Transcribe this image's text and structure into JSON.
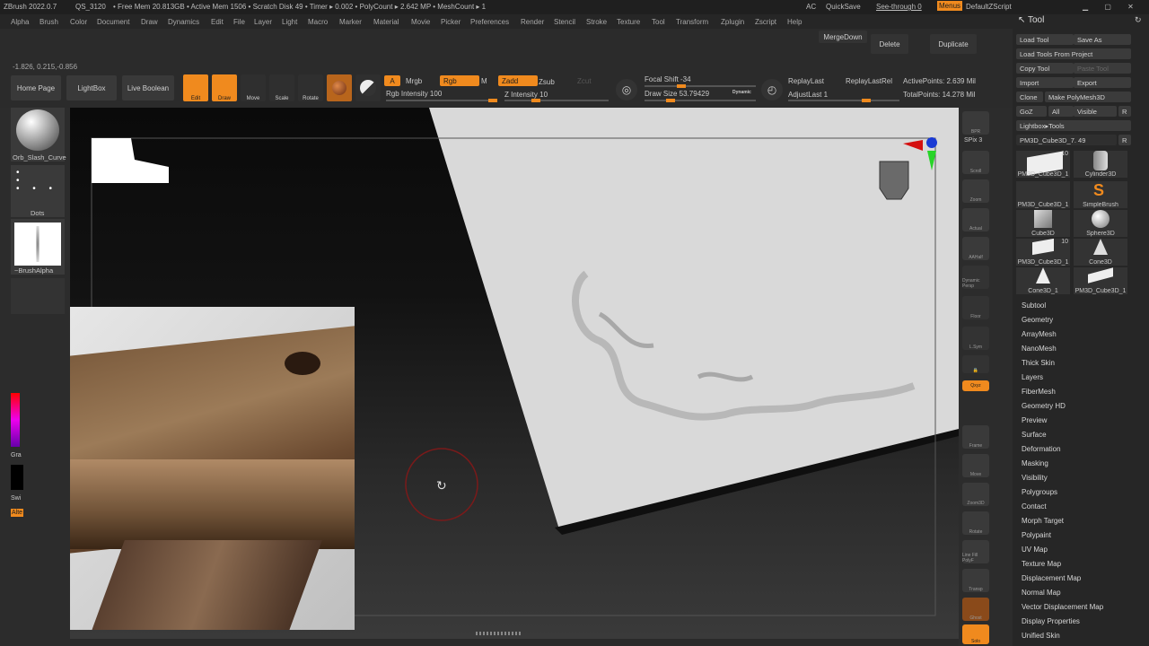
{
  "titlebar": {
    "app": "ZBrush 2022.0.7",
    "qs": "QS_3120",
    "stats": "• Free Mem 20.813GB • Active Mem 1506 • Scratch Disk 49 • Timer ▸ 0.002 • PolyCount ▸ 2.642 MP • MeshCount ▸ 1",
    "ac": "AC",
    "quicksave": "QuickSave",
    "see_through": "See-through  0",
    "menus": "Menus",
    "zscript": "DefaultZScript"
  },
  "menubar": [
    "Alpha",
    "Brush",
    "Color",
    "Document",
    "Draw",
    "Dynamics",
    "Edit",
    "File",
    "Layer",
    "Light",
    "Macro",
    "Marker",
    "Material",
    "Movie",
    "Picker",
    "Preferences",
    "Render",
    "Stencil",
    "Stroke",
    "Texture",
    "Tool",
    "Transform",
    "Zplugin",
    "Zscript",
    "Help"
  ],
  "topshelf": {
    "coords": "-1.826, 0.215,-0.856",
    "merge_down": "MergeDown",
    "delete": "Delete",
    "duplicate": "Duplicate",
    "home_page": "Home Page",
    "lightbox": "LightBox",
    "live_boolean": "Live Boolean",
    "edit": "Edit",
    "draw": "Draw",
    "move": "Move",
    "scale": "Scale",
    "rotate": "Rotate",
    "a": "A",
    "mrgb": "Mrgb",
    "rgb": "Rgb",
    "m": "M",
    "zadd": "Zadd",
    "zsub": "Zsub",
    "zcut": "Zcut",
    "rgb_intensity": "Rgb Intensity 100",
    "z_intensity": "Z Intensity 10",
    "focal_shift": "Focal Shift -34",
    "draw_size": "Draw Size 53.79429",
    "dynamic": "Dynamic",
    "replay_last": "ReplayLast",
    "replay_last_rel": "ReplayLastRel",
    "adjust_last": "AdjustLast 1",
    "active_points": "ActivePoints: 2.639 Mil",
    "total_points": "TotalPoints: 14.278 Mil"
  },
  "leftshelf": {
    "brush": "Orb_Slash_Curve",
    "stroke": "Dots",
    "alpha": "~BrushAlpha",
    "gradient": "Gra",
    "switch": "Swi",
    "alternate": "Alte"
  },
  "rightshelf": [
    "BPR",
    "SPix 3",
    "Scroll",
    "Zoom",
    "Actual",
    "AAHalf",
    "Dynamic Persp",
    "Floor",
    "L.Sym",
    "",
    "Qxyz",
    "",
    "",
    "Frame",
    "Move",
    "Zoom3D",
    "Rotate",
    "Line Fill PolyF",
    "Transp",
    "Ghost",
    "Solo"
  ],
  "tray": {
    "header": "Tool",
    "load_tool": "Load Tool",
    "save_as": "Save As",
    "load_from_project": "Load Tools From Project",
    "copy_tool": "Copy Tool",
    "paste_tool": "Paste Tool",
    "import": "Import",
    "export": "Export",
    "clone": "Clone",
    "make_polymesh": "Make PolyMesh3D",
    "goz": "GoZ",
    "all": "All",
    "visible": "Visible",
    "r": "R",
    "lightbox_tools": "Lightbox▸Tools",
    "current_tool": "PM3D_Cube3D_7. 49",
    "tools": [
      {
        "name": "PM3D_Cube3D_1",
        "count": "10"
      },
      {
        "name": "Cylinder3D",
        "count": ""
      },
      {
        "name": "PM3D_Cube3D_1",
        "count": ""
      },
      {
        "name": "SimpleBrush",
        "count": ""
      },
      {
        "name": "Cube3D",
        "count": ""
      },
      {
        "name": "Sphere3D",
        "count": ""
      },
      {
        "name": "PM3D_Cube3D_1",
        "count": "10"
      },
      {
        "name": "Cone3D",
        "count": ""
      },
      {
        "name": "Cone3D_1",
        "count": ""
      },
      {
        "name": "PM3D_Cube3D_1",
        "count": ""
      }
    ],
    "subpalettes": [
      "Subtool",
      "Geometry",
      "ArrayMesh",
      "NanoMesh",
      "Thick Skin",
      "Layers",
      "FiberMesh",
      "Geometry HD",
      "Preview",
      "Surface",
      "Deformation",
      "Masking",
      "Visibility",
      "Polygroups",
      "Contact",
      "Morph Target",
      "Polypaint",
      "UV Map",
      "Texture Map",
      "Displacement Map",
      "Normal Map",
      "Vector Displacement Map",
      "Display Properties",
      "Unified Skin"
    ]
  },
  "colors": {
    "accent": "#f08a1e",
    "panel": "#2b2b2b",
    "canvas_dark": "#0a0a0a"
  }
}
